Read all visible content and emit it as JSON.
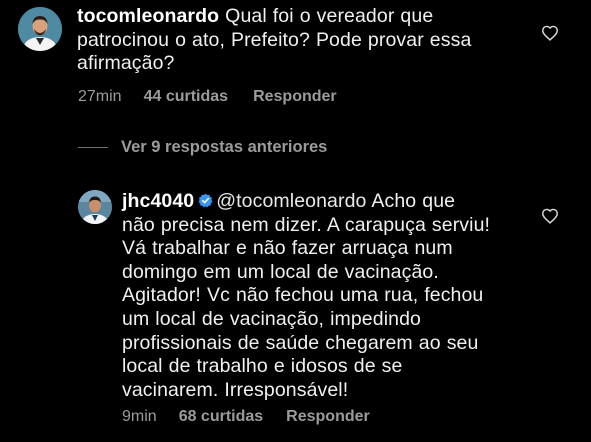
{
  "comment1": {
    "username": "tocomleonardo",
    "text_line1": " Qual foi o vereador que",
    "text_line2": "patrocinou o ato, Prefeito? Pode provar essa",
    "text_line3": "afirmação?",
    "time": "27min",
    "likes": "44 curtidas",
    "reply": "Responder",
    "like_icon": "heart-outline"
  },
  "view_replies": {
    "label": "Ver 9 respostas anteriores"
  },
  "comment2": {
    "username": "jhc4040",
    "verified_icon": "verified-badge",
    "mention": "@tocomleonardo",
    "text_line1_rest": " Acho que",
    "lines": [
      "não precisa nem dizer. A carapuça serviu!",
      "Vá trabalhar e não fazer arruaça num",
      "domingo em um local de vacinação.",
      "Agitador! Vc não fechou uma rua, fechou",
      "um local de vacinação, impedindo",
      "profissionais de saúde chegarem ao seu",
      "local de trabalho e idosos de se",
      "vacinarem. Irresponsável!"
    ],
    "time": "9min",
    "likes": "68 curtidas",
    "reply": "Responder",
    "like_icon": "heart-outline"
  },
  "colors": {
    "background": "#000000",
    "text": "#f0f0f0",
    "secondary": "#9b9b9b",
    "verified": "#3897f0"
  }
}
